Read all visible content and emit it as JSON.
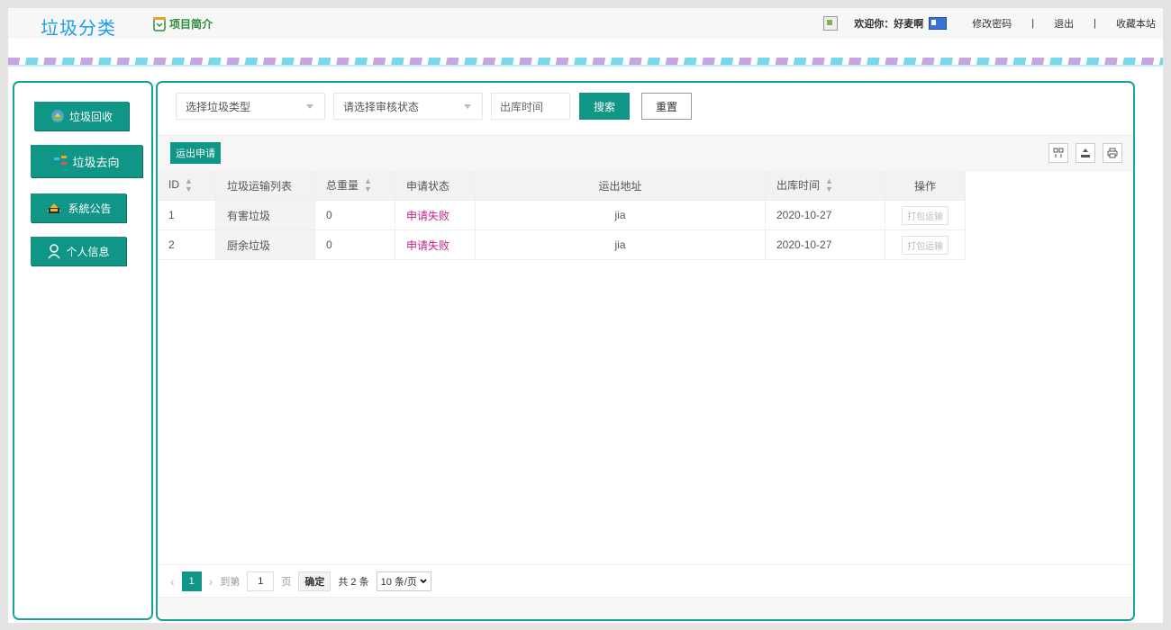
{
  "header": {
    "logo": "垃圾分类",
    "intro_label": "项目简介",
    "welcome": "欢迎你：好麦啊",
    "change_password": "修改密码",
    "separator": "|",
    "logout": "退出",
    "bookmark": "收藏本站"
  },
  "sidebar": {
    "items": [
      {
        "label": "垃圾回收",
        "icon": "recycle-icon"
      },
      {
        "label": "垃圾去向",
        "icon": "direction-icon"
      },
      {
        "label": "系統公告",
        "icon": "notice-icon"
      },
      {
        "label": "个人信息",
        "icon": "user-icon"
      }
    ]
  },
  "filters": {
    "type_placeholder": "选择垃圾类型",
    "status_placeholder": "请选择审核状态",
    "date_placeholder": "出库时间",
    "search_label": "搜索",
    "reset_label": "重置"
  },
  "toolbar": {
    "apply_label": "运出申请",
    "icons": [
      "columns-icon",
      "export-icon",
      "print-icon"
    ]
  },
  "table": {
    "headers": [
      "ID",
      "垃圾运输列表",
      "总重量",
      "申请状态",
      "运出地址",
      "出库时间",
      "操作"
    ],
    "rows": [
      {
        "id": "1",
        "name": "有害垃圾",
        "weight": "0",
        "status": "申请失败",
        "address": "jia",
        "date": "2020-10-27",
        "action": "打包运输"
      },
      {
        "id": "2",
        "name": "厨余垃圾",
        "weight": "0",
        "status": "申请失败",
        "address": "jia",
        "date": "2020-10-27",
        "action": "打包运输"
      }
    ]
  },
  "pager": {
    "prev": "‹",
    "current": "1",
    "next": "›",
    "goto_label": "到第",
    "goto_value": "1",
    "page_label": "页",
    "confirm_label": "确定",
    "total": "共 2 条",
    "page_size": "10 条/页"
  },
  "colors": {
    "accent": "#0f9687",
    "border": "#18a29a",
    "logo": "#1a9ee8",
    "status_fail": "#c1228a"
  }
}
